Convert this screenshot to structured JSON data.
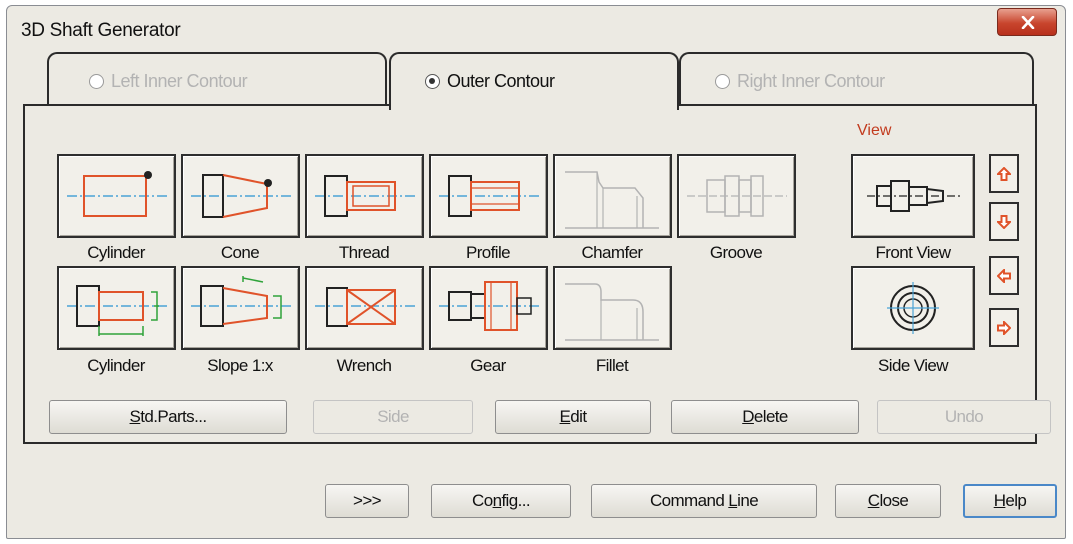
{
  "window": {
    "title": "3D Shaft Generator"
  },
  "tabs": [
    {
      "label": "Left Inner Contour",
      "state": "disabled"
    },
    {
      "label": "Outer Contour",
      "state": "selected"
    },
    {
      "label": "Right Inner Contour",
      "state": "disabled"
    }
  ],
  "tools": {
    "row1": [
      {
        "label": "Cylinder",
        "icon": "cylinder-icon"
      },
      {
        "label": "Cone",
        "icon": "cone-icon"
      },
      {
        "label": "Thread",
        "icon": "thread-icon"
      },
      {
        "label": "Profile",
        "icon": "profile-icon"
      },
      {
        "label": "Chamfer",
        "icon": "chamfer-icon"
      },
      {
        "label": "Groove",
        "icon": "groove-icon"
      }
    ],
    "row2": [
      {
        "label": "Cylinder",
        "icon": "cylinder-sloped-icon"
      },
      {
        "label": "Slope 1:x",
        "icon": "slope-icon"
      },
      {
        "label": "Wrench",
        "icon": "wrench-icon"
      },
      {
        "label": "Gear",
        "icon": "gear-icon"
      },
      {
        "label": "Fillet",
        "icon": "fillet-icon"
      }
    ]
  },
  "view": {
    "label": "View",
    "front": {
      "label": "Front View",
      "icon": "front-view-icon"
    },
    "side": {
      "label": "Side View",
      "icon": "side-view-icon"
    },
    "arrows": [
      "arrow-up-icon",
      "arrow-down-icon",
      "arrow-left-icon",
      "arrow-right-icon"
    ]
  },
  "panel_buttons": {
    "std_parts": {
      "pre": "",
      "u": "S",
      "post": "td.Parts..."
    },
    "side": {
      "label": "Side"
    },
    "edit": {
      "pre": "",
      "u": "E",
      "post": "dit"
    },
    "delete": {
      "pre": "",
      "u": "D",
      "post": "elete"
    },
    "undo": {
      "label": "Undo"
    }
  },
  "footer_buttons": {
    "more": {
      "label": ">>>"
    },
    "config": {
      "pre": "Co",
      "u": "n",
      "post": "fig..."
    },
    "command_line": {
      "pre": "Command ",
      "u": "L",
      "post": "ine"
    },
    "close": {
      "pre": "",
      "u": "C",
      "post": "lose"
    },
    "help": {
      "pre": "",
      "u": "H",
      "post": "elp"
    }
  },
  "colors": {
    "accent": "#e0532a",
    "center_line": "#4aa3d6",
    "dim_green": "#2fa33a",
    "outline": "#2b2b2b",
    "focus": "#4a88c8"
  }
}
